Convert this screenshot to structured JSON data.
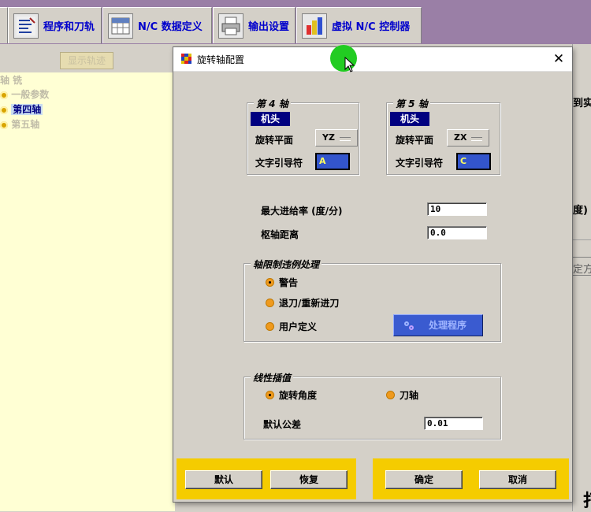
{
  "tabs": [
    {
      "label": "程序和刀轨",
      "icon": "program-toolpath-icon"
    },
    {
      "label": "N/C 数据定义",
      "icon": "nc-data-table-icon"
    },
    {
      "label": "输出设置",
      "icon": "printer-icon"
    },
    {
      "label": "虚拟 N/C 控制器",
      "icon": "virtual-controller-icon"
    }
  ],
  "left_panel": {
    "button_label": "显示轨迹",
    "tree": [
      {
        "label": "轴 铣",
        "state": "dim"
      },
      {
        "label": "一般参数",
        "state": "dim"
      },
      {
        "label": "第四轴",
        "state": "selected"
      },
      {
        "label": "第五轴",
        "state": "dim"
      }
    ]
  },
  "background_fragments": {
    "top_right": "到实",
    "mid_right": "度)",
    "lower_right": "定方",
    "bottom_right": "打"
  },
  "dialog": {
    "title": "旋转轴配置",
    "close_glyph": "✕",
    "axis4": {
      "title": "第 4 轴",
      "type_badge": "机头",
      "plane_label": "旋转平面",
      "plane_value": "YZ",
      "leader_label": "文字引导符",
      "leader_value": "A"
    },
    "axis5": {
      "title": "第 5 轴",
      "type_badge": "机头",
      "plane_label": "旋转平面",
      "plane_value": "ZX",
      "leader_label": "文字引导符",
      "leader_value": "C"
    },
    "max_feed_label": "最大进给率 (度/分)",
    "max_feed_value": "10",
    "pivot_label": "枢轴距离",
    "pivot_value": "0.0",
    "limit_group": {
      "title": "轴限制违例处理",
      "options": [
        {
          "label": "警告",
          "selected": true
        },
        {
          "label": "退刀/重新进刀",
          "selected": false
        },
        {
          "label": "用户定义",
          "selected": false
        }
      ],
      "handler_button": "处理程序"
    },
    "linear_group": {
      "title": "线性插值",
      "option_rotation": "旋转角度",
      "option_rotation_selected": true,
      "option_tool_axis": "刀轴",
      "option_tool_axis_selected": false,
      "tolerance_label": "默认公差",
      "tolerance_value": "0.01"
    },
    "footer": {
      "default_label": "默认",
      "restore_label": "恢复",
      "ok_label": "确定",
      "cancel_label": "取消"
    }
  },
  "colors": {
    "tabbar": "#9a7fa6",
    "tab_text": "#0000cc",
    "tree_bg": "#ffffd4",
    "badge_bg": "#000080",
    "footer_yellow": "#f5cc00",
    "radio_orange": "#ef9a1e",
    "process_button": "#3a5bd0",
    "cursor_halo": "#22cc22"
  }
}
